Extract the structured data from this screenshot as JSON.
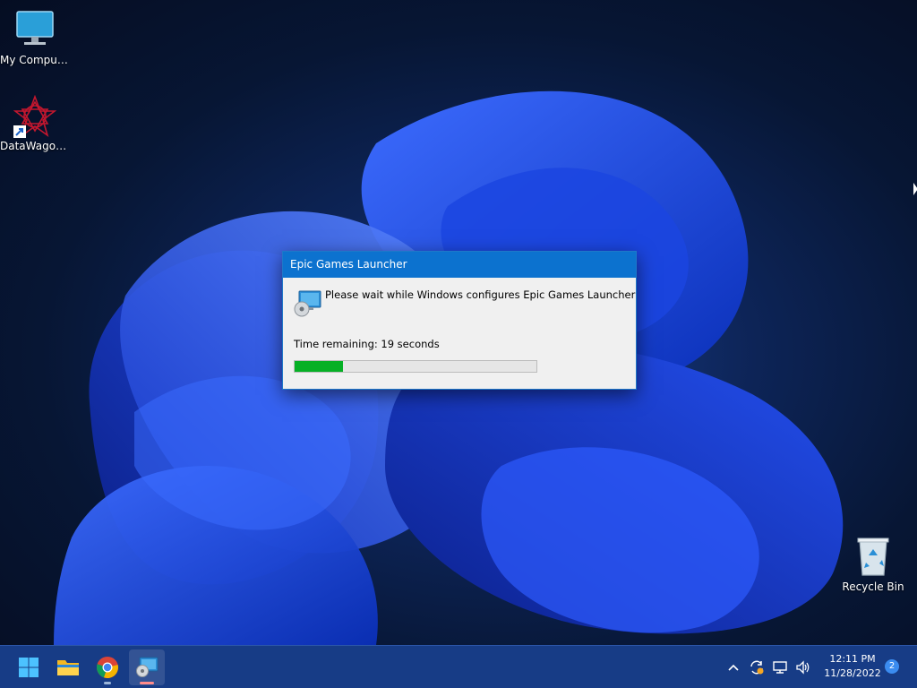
{
  "desktop": {
    "icons": [
      {
        "label": "My Computer",
        "icon": "monitor-icon"
      },
      {
        "label": "DataWagon...",
        "icon": "datawagon-app-icon"
      },
      {
        "label": "Recycle Bin",
        "icon": "recycle-bin-icon"
      }
    ]
  },
  "dialog": {
    "title": "Epic Games Launcher",
    "message": "Please wait while Windows configures Epic Games Launcher",
    "time_remaining": "Time remaining: 19 seconds",
    "progress": 0.2,
    "accent": "#0c72cf",
    "progress_color": "#06b025"
  },
  "taskbar": {
    "apps": [
      {
        "name": "Start",
        "icon": "windows-start-icon"
      },
      {
        "name": "File Explorer",
        "icon": "folder-icon"
      },
      {
        "name": "Google Chrome",
        "icon": "chrome-icon"
      },
      {
        "name": "Windows Installer",
        "icon": "installer-icon"
      }
    ],
    "tray_icons": [
      "chevron-up-icon",
      "sync-icon",
      "network-icon",
      "volume-icon"
    ],
    "clock": {
      "time": "12:11 PM",
      "date": "11/28/2022"
    },
    "notification_count": "2"
  }
}
